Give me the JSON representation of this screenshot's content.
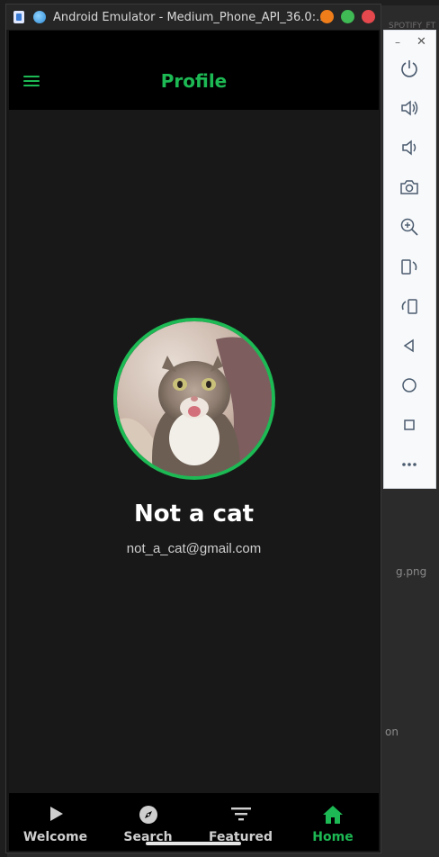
{
  "window": {
    "title": "Android Emulator - Medium_Phone_API_36.0:..."
  },
  "app": {
    "title": "Profile",
    "accent_color": "#1db954"
  },
  "profile": {
    "name": "Not a cat",
    "email": "not_a_cat@gmail.com"
  },
  "bottom_nav": {
    "items": [
      {
        "label": "Welcome",
        "icon": "play-icon",
        "active": false
      },
      {
        "label": "Search",
        "icon": "compass-icon",
        "active": false
      },
      {
        "label": "Featured",
        "icon": "filter-icon",
        "active": false
      },
      {
        "label": "Home",
        "icon": "home-icon",
        "active": true
      }
    ]
  },
  "toolbar": {
    "buttons": [
      "power-icon",
      "volume-up-icon",
      "volume-down-icon",
      "camera-icon",
      "zoom-icon",
      "rotate-left-icon",
      "rotate-right-icon",
      "back-icon",
      "home-circle-icon",
      "overview-icon",
      "more-icon"
    ]
  },
  "desktop": {
    "file_label": "g.png",
    "side_text": "on",
    "top_text": "SPOTIFY_FT"
  }
}
